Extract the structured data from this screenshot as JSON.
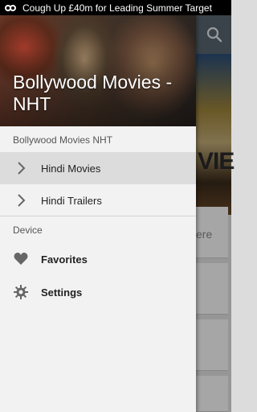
{
  "status_bar": {
    "notification_text": "Cough Up £40m for Leading Summer Target",
    "icon": "infinity-icon"
  },
  "drawer": {
    "header_title": "Bollywood Movies - NHT",
    "section_app_label": "Bollywood Movies NHT",
    "items": [
      {
        "label": "Hindi Movies",
        "icon": "chevron-right-icon",
        "active": true
      },
      {
        "label": "Hindi Trailers",
        "icon": "chevron-right-icon",
        "active": false
      }
    ],
    "section_device_label": "Device",
    "device_items": [
      {
        "label": "Favorites",
        "icon": "heart-icon"
      },
      {
        "label": "Settings",
        "icon": "gear-icon"
      }
    ]
  },
  "background": {
    "poster_text": "VIE",
    "card_text": "ere",
    "search_icon": "search-icon"
  },
  "colors": {
    "drawer_bg": "#f2f2f2",
    "active_item_bg": "#dcdcdc",
    "toolbar_bg": "#5a6770"
  }
}
